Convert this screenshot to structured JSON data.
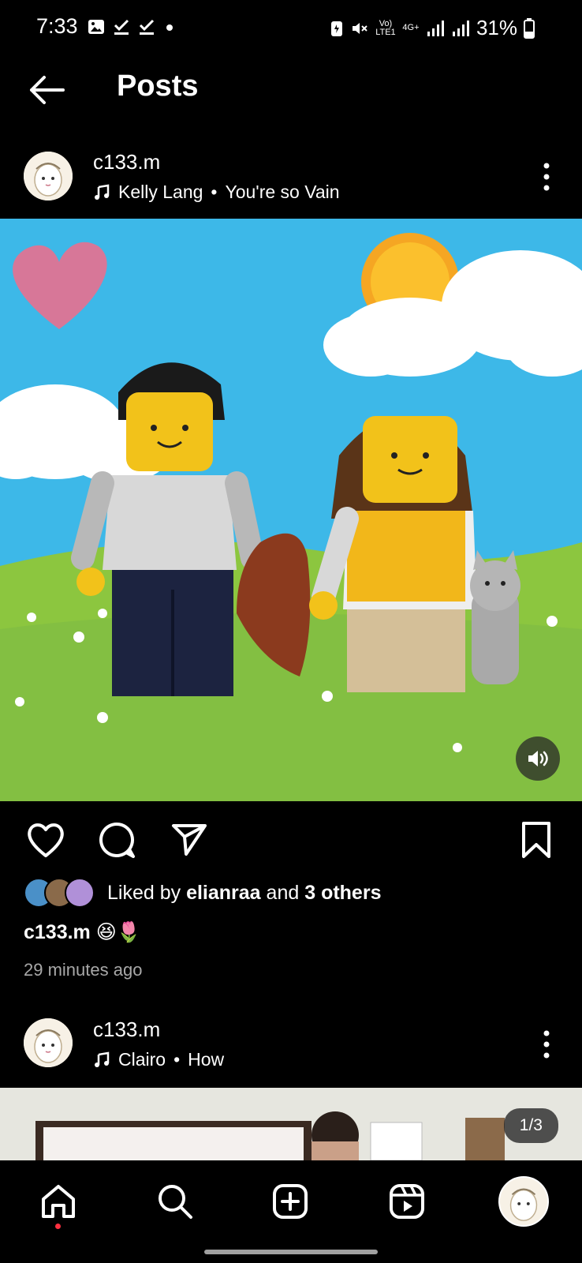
{
  "status_bar": {
    "time": "7:33",
    "battery": "31%",
    "network": "Vo) LTE1",
    "network2": "4G+"
  },
  "header": {
    "title": "Posts"
  },
  "post1": {
    "username": "c133.m",
    "music_artist": "Kelly Lang",
    "music_separator": "•",
    "music_song": "You're so Vain",
    "likes_prefix": "Liked by",
    "likes_user": "elianraa",
    "likes_suffix": "and",
    "likes_others": "3 others",
    "caption_user": "c133.m",
    "caption_text": "😆🌷",
    "time_ago": "29 minutes ago"
  },
  "post2": {
    "username": "c133.m",
    "music_artist": "Clairo",
    "music_separator": "•",
    "music_song": "How",
    "carousel_indicator": "1/3"
  },
  "icons": {
    "back": "arrow-left-icon",
    "more": "more-vertical-icon",
    "like": "heart-icon",
    "comment": "comment-icon",
    "share": "send-icon",
    "save": "bookmark-icon",
    "sound": "volume-icon",
    "home": "home-icon",
    "search": "search-icon",
    "create": "plus-square-icon",
    "reels": "reels-icon",
    "profile": "profile-avatar-icon"
  },
  "colors": {
    "background": "#000000",
    "text": "#ffffff",
    "muted": "#a8a8a8",
    "notification_dot": "#ff3040",
    "sky": "#3db8e8",
    "grass": "#8cc63f"
  }
}
